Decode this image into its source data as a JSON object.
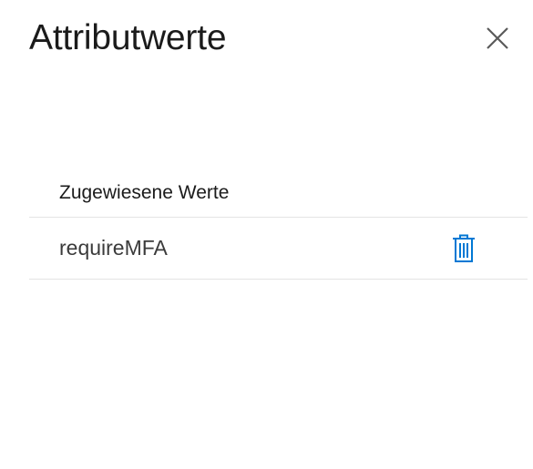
{
  "panel": {
    "title": "Attributwerte",
    "close_icon": "close-icon"
  },
  "table": {
    "header": "Zugewiesene Werte",
    "rows": [
      {
        "value": "requireMFA",
        "action_icon": "trash-icon"
      }
    ]
  },
  "colors": {
    "accent": "#0078d4",
    "text": "#1b1b1b",
    "divider": "#e4e4e4"
  }
}
